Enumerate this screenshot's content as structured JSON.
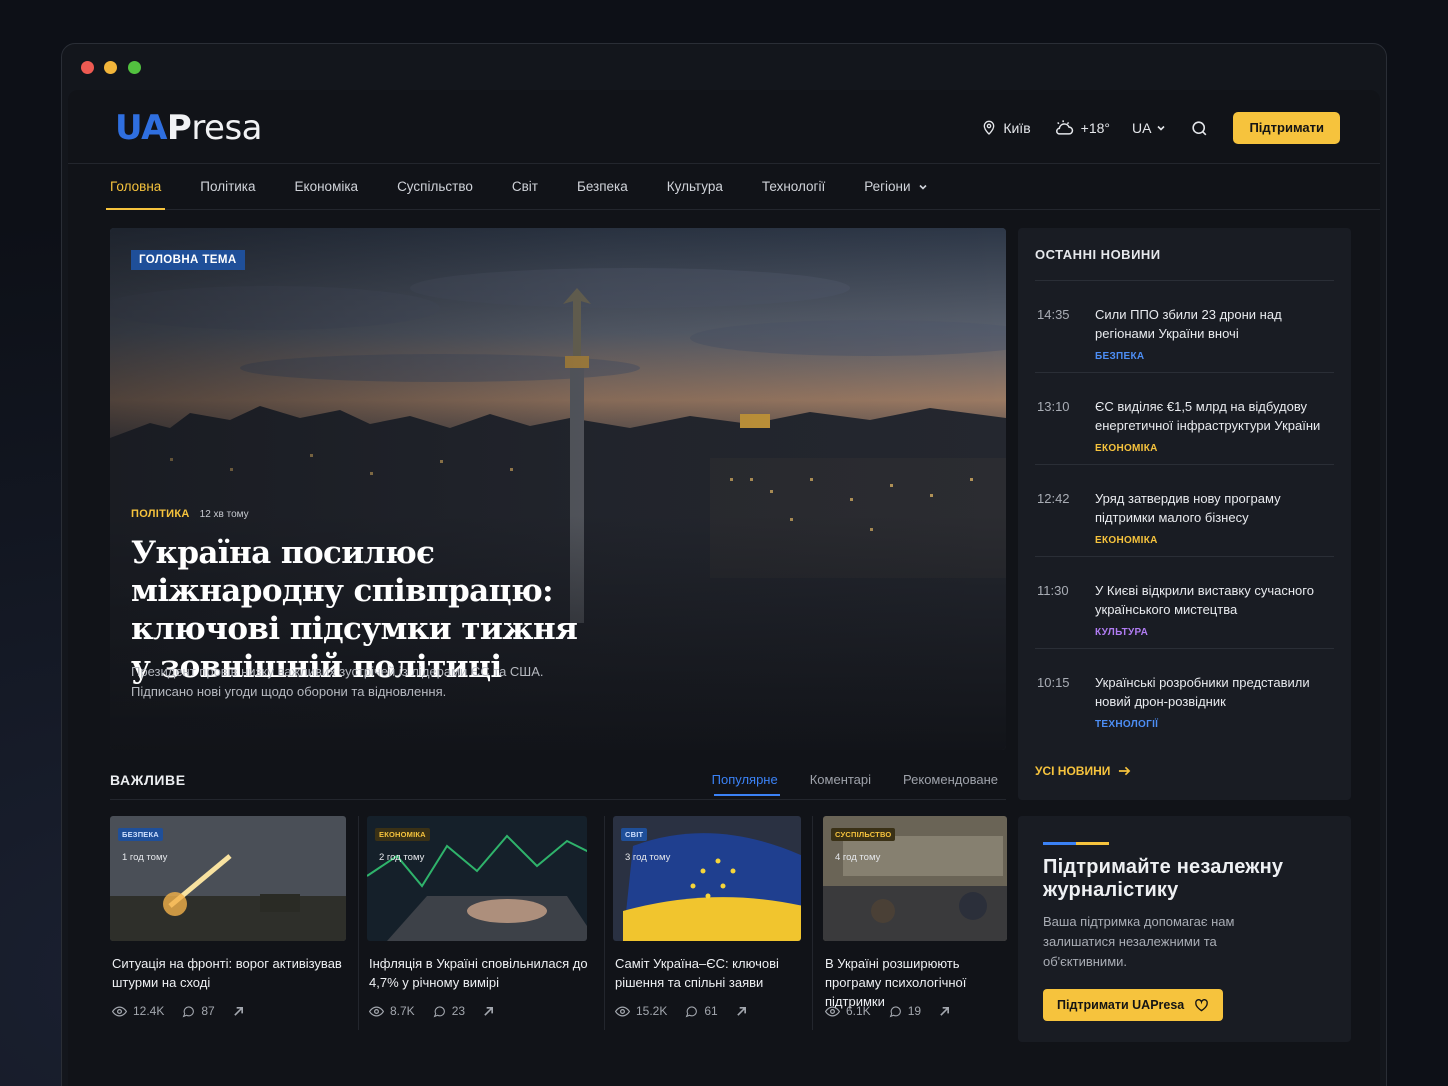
{
  "brand": {
    "logo_ua": "UA",
    "logo_p": "P",
    "logo_rest": "resa"
  },
  "header": {
    "city": "Київ",
    "temperature": "+18°",
    "language": "UA",
    "support_label": "Підтримати",
    "icons": {
      "location": "location-pin-icon",
      "weather": "partly-cloudy-icon",
      "search": "search-icon"
    }
  },
  "nav": {
    "items": [
      "Головна",
      "Політика",
      "Економіка",
      "Суспільство",
      "Світ",
      "Безпека",
      "Культура",
      "Технології",
      "Регіони"
    ],
    "active": "Головна"
  },
  "hero": {
    "tag": "ГОЛОВНА ТЕМА",
    "category": "ПОЛІТИКА",
    "time": "12 хв тому",
    "title": "Україна посилює міжнародну співпрацю: ключові підсумки тижня у зовнішній політиці",
    "subtitle": "Президент провів низку важливих зустрічей із лідерами ЄС та США. Підписано нові угоди щодо оборони та відновлення."
  },
  "latest": {
    "title": "ОСТАННІ НОВИНИ",
    "items": [
      {
        "time": "14:35",
        "text": "Сили ППО збили 23 дрони над регіонами України вночі",
        "category": "БЕЗПЕКА",
        "color": "#4d8ef5"
      },
      {
        "time": "13:10",
        "text": "ЄС виділяє €1,5 млрд на відбудову енергетичної інфраструктури України",
        "category": "ЕКОНОМІКА",
        "color": "#f6c33d"
      },
      {
        "time": "12:42",
        "text": "Уряд затвердив нову програму підтримки малого бізнесу",
        "category": "ЕКОНОМІКА",
        "color": "#f6c33d"
      },
      {
        "time": "11:30",
        "text": "У Києві відкрили виставку сучасного українського мистецтва",
        "category": "КУЛЬТУРА",
        "color": "#b07cf2"
      },
      {
        "time": "10:15",
        "text": "Українські розробники представили новий дрон-розвідник",
        "category": "ТЕХНОЛОГІЇ",
        "color": "#4d8ef5"
      }
    ],
    "all_label": "УСІ НОВИНИ"
  },
  "important": {
    "title": "ВАЖЛИВЕ",
    "tabs": [
      "Популярне",
      "Коментарі",
      "Рекомендоване"
    ],
    "active_tab": "Популярне",
    "cards": [
      {
        "tag": "БЕЗПЕКА",
        "tag_bg": "#1f4f99",
        "tag_fg": "#cfe0ff",
        "time": "1 год тому",
        "title": "Ситуація на фронті: ворог активізував штурми на сході",
        "views": "12.4K",
        "comments": "87"
      },
      {
        "tag": "ЕКОНОМІКА",
        "tag_bg": "#3a3116",
        "tag_fg": "#f6c33d",
        "time": "2 год тому",
        "title": "Інфляція в Україні сповільнилася до 4,7% у річному вимірі",
        "views": "8.7K",
        "comments": "23"
      },
      {
        "tag": "СВІТ",
        "tag_bg": "#1f4f99",
        "tag_fg": "#cfe0ff",
        "time": "3 год тому",
        "title": "Саміт Україна–ЄС: ключові рішення та спільні заяви",
        "views": "15.2K",
        "comments": "61"
      },
      {
        "tag": "СУСПІЛЬСТВО",
        "tag_bg": "#3a3116",
        "tag_fg": "#f6c33d",
        "time": "4 год тому",
        "title": "В Україні розширюють програму психологічної підтримки",
        "views": "6.1K",
        "comments": "19"
      }
    ]
  },
  "support_box": {
    "title": "Підтримайте незалежну журналістику",
    "text": "Ваша підтримка допомагає нам залишатися незалежними та об'єктивними.",
    "button": "Підтримати UAPresa"
  },
  "colors": {
    "accent": "#f6c33d",
    "blue": "#3b82f6",
    "bg": "#111318",
    "panel": "#191c23"
  }
}
